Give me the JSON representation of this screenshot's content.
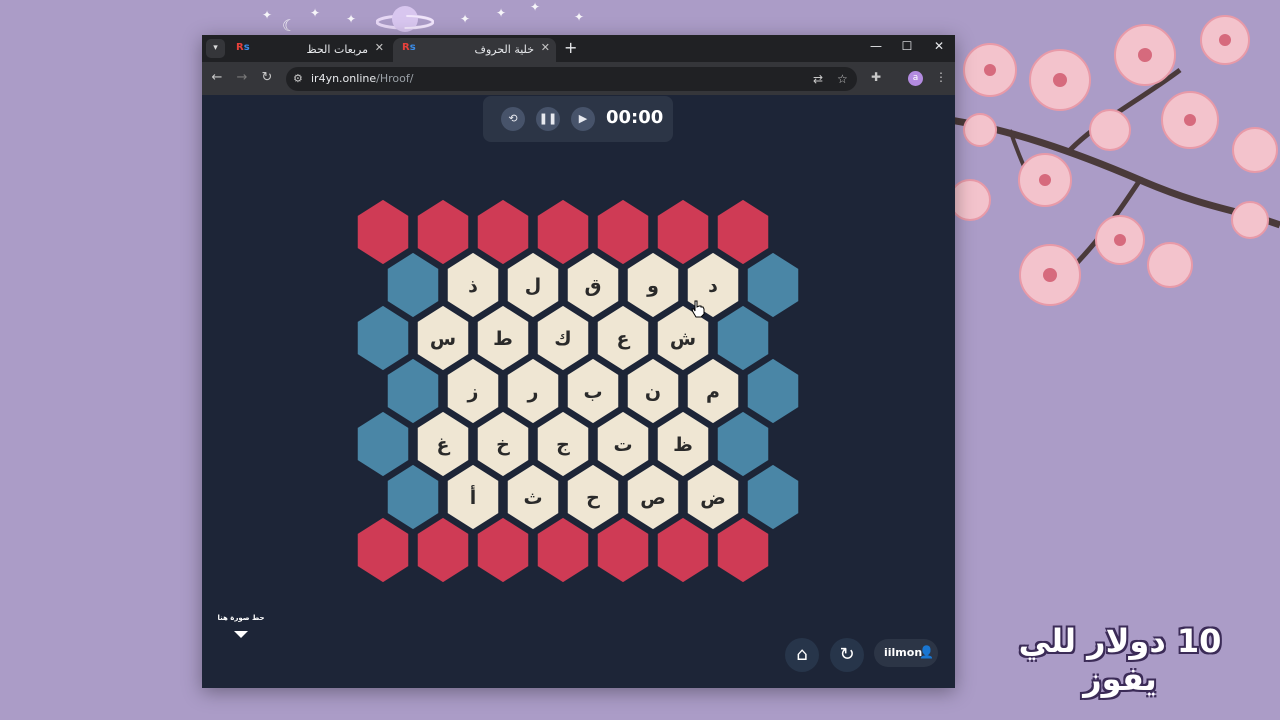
{
  "browser": {
    "tabs": [
      {
        "title": "مربعات الحظ",
        "active": false,
        "favicon_text": "R"
      },
      {
        "title": "خلية الحروف",
        "active": true,
        "favicon_text": "R"
      }
    ],
    "url_host": "ir4yn.online",
    "url_path": "/Hroof/",
    "profile_initial": "a"
  },
  "timer": {
    "time": "00:00",
    "buttons": [
      "reset-icon",
      "pause-icon",
      "play-icon"
    ]
  },
  "board": {
    "colors": {
      "red": "#cf3b55",
      "blue": "#4a86a6",
      "cream": "#efe6d3"
    },
    "rows": [
      [
        "red",
        "red",
        "red",
        "red",
        "red",
        "red",
        "red"
      ],
      [
        "blue",
        "ذ",
        "ل",
        "ق",
        "و",
        "د",
        "blue"
      ],
      [
        "blue",
        "س",
        "ط",
        "ك",
        "ع",
        "ش",
        "blue"
      ],
      [
        "blue",
        "ز",
        "ر",
        "ب",
        "ن",
        "م",
        "blue"
      ],
      [
        "blue",
        "غ",
        "خ",
        "ج",
        "ت",
        "ظ",
        "blue"
      ],
      [
        "blue",
        "أ",
        "ث",
        "ح",
        "ص",
        "ض",
        "blue"
      ],
      [
        "red",
        "red",
        "red",
        "red",
        "red",
        "red",
        "red"
      ]
    ]
  },
  "footer": {
    "drop_label": "حط صورة هنا",
    "home_icon": "home-icon",
    "refresh_icon": "refresh-icon",
    "username": "iilmon",
    "user_icon": "user-icon"
  },
  "overlay_caption": "10 دولار للي يفوز"
}
